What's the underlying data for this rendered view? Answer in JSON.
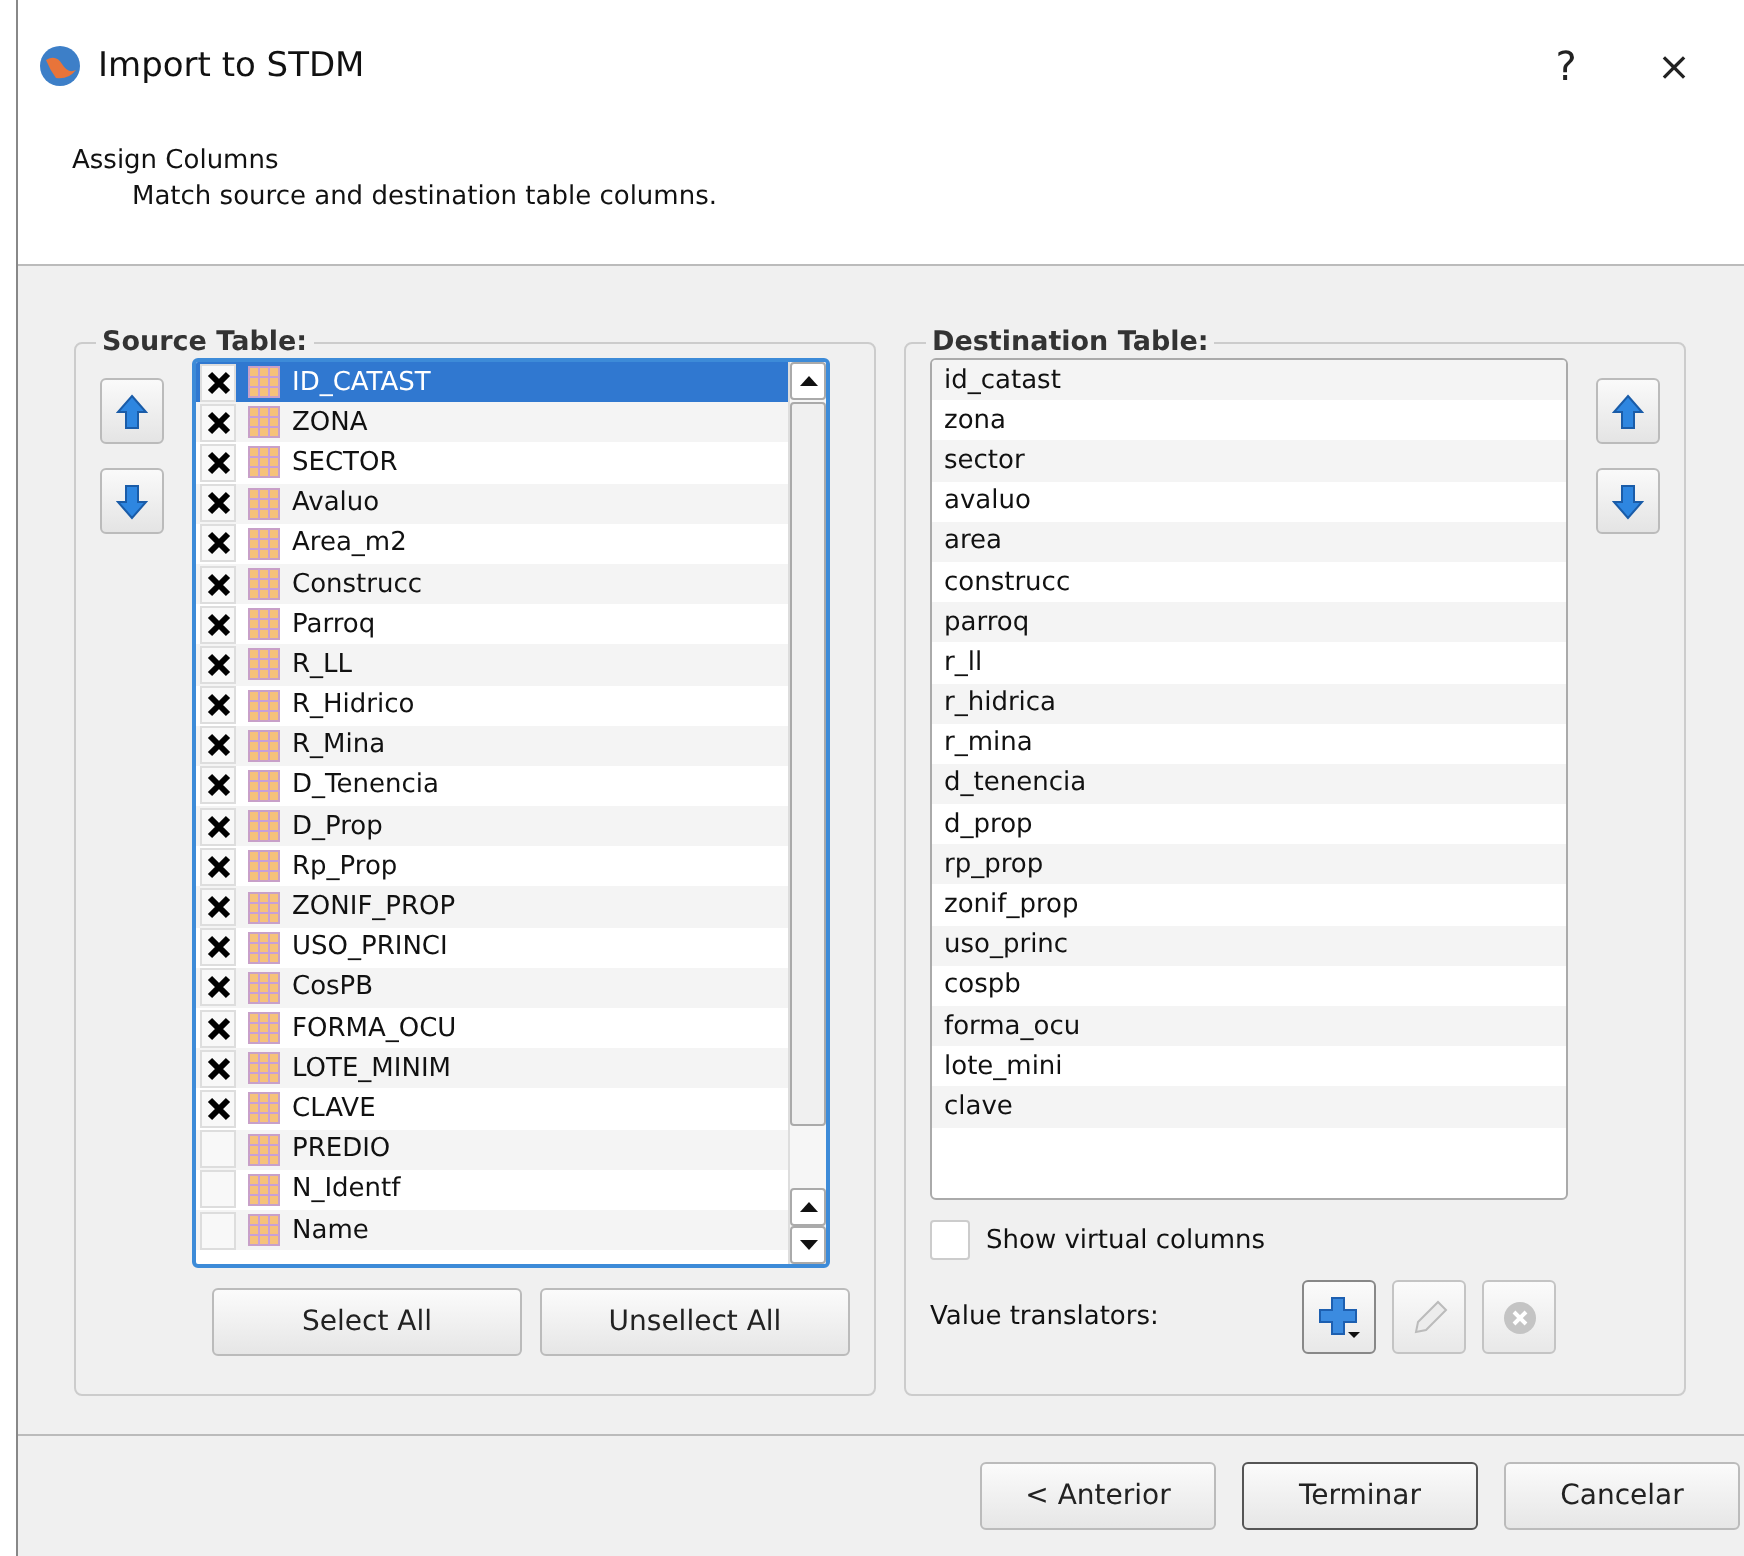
{
  "window": {
    "title": "Import to STDM",
    "help": "?",
    "close": "×"
  },
  "header": {
    "title": "Assign Columns",
    "subtitle": "Match source and destination table columns."
  },
  "source_table": {
    "title": "Source Table:",
    "items": [
      {
        "label": "ID_CATAST",
        "checked": true,
        "selected": true
      },
      {
        "label": "ZONA",
        "checked": true,
        "selected": false
      },
      {
        "label": "SECTOR",
        "checked": true,
        "selected": false
      },
      {
        "label": "Avaluo",
        "checked": true,
        "selected": false
      },
      {
        "label": "Area_m2",
        "checked": true,
        "selected": false
      },
      {
        "label": "Construcc",
        "checked": true,
        "selected": false
      },
      {
        "label": "Parroq",
        "checked": true,
        "selected": false
      },
      {
        "label": "R_LL",
        "checked": true,
        "selected": false
      },
      {
        "label": "R_Hidrico",
        "checked": true,
        "selected": false
      },
      {
        "label": "R_Mina",
        "checked": true,
        "selected": false
      },
      {
        "label": "D_Tenencia",
        "checked": true,
        "selected": false
      },
      {
        "label": "D_Prop",
        "checked": true,
        "selected": false
      },
      {
        "label": "Rp_Prop",
        "checked": true,
        "selected": false
      },
      {
        "label": "ZONIF_PROP",
        "checked": true,
        "selected": false
      },
      {
        "label": "USO_PRINCI",
        "checked": true,
        "selected": false
      },
      {
        "label": "CosPB",
        "checked": true,
        "selected": false
      },
      {
        "label": "FORMA_OCU",
        "checked": true,
        "selected": false
      },
      {
        "label": "LOTE_MINIM",
        "checked": true,
        "selected": false
      },
      {
        "label": "CLAVE",
        "checked": true,
        "selected": false
      },
      {
        "label": "PREDIO",
        "checked": false,
        "selected": false
      },
      {
        "label": "N_Identf",
        "checked": false,
        "selected": false
      },
      {
        "label": "Name",
        "checked": false,
        "selected": false
      }
    ],
    "buttons": [
      "Select All",
      "Unsellect All"
    ]
  },
  "destination_table": {
    "title": "Destination Table:",
    "items": [
      "id_catast",
      "zona",
      "sector",
      "avaluo",
      "area",
      "construcc",
      "parroq",
      "r_ll",
      "r_hidrica",
      "r_mina",
      "d_tenencia",
      "d_prop",
      "rp_prop",
      "zonif_prop",
      "uso_princ",
      "cospb",
      "forma_ocu",
      "lote_mini",
      "clave"
    ],
    "show_virtual_columns": {
      "label": "Show virtual columns",
      "checked": false
    },
    "value_translators": {
      "label": "Value translators:",
      "buttons": [
        {
          "kind": "add",
          "disabled": false
        },
        {
          "kind": "edit",
          "disabled": true
        },
        {
          "kind": "remove",
          "disabled": true
        }
      ]
    }
  },
  "buttons": [
    "< Anterior",
    "Terminar",
    "Cancelar"
  ]
}
